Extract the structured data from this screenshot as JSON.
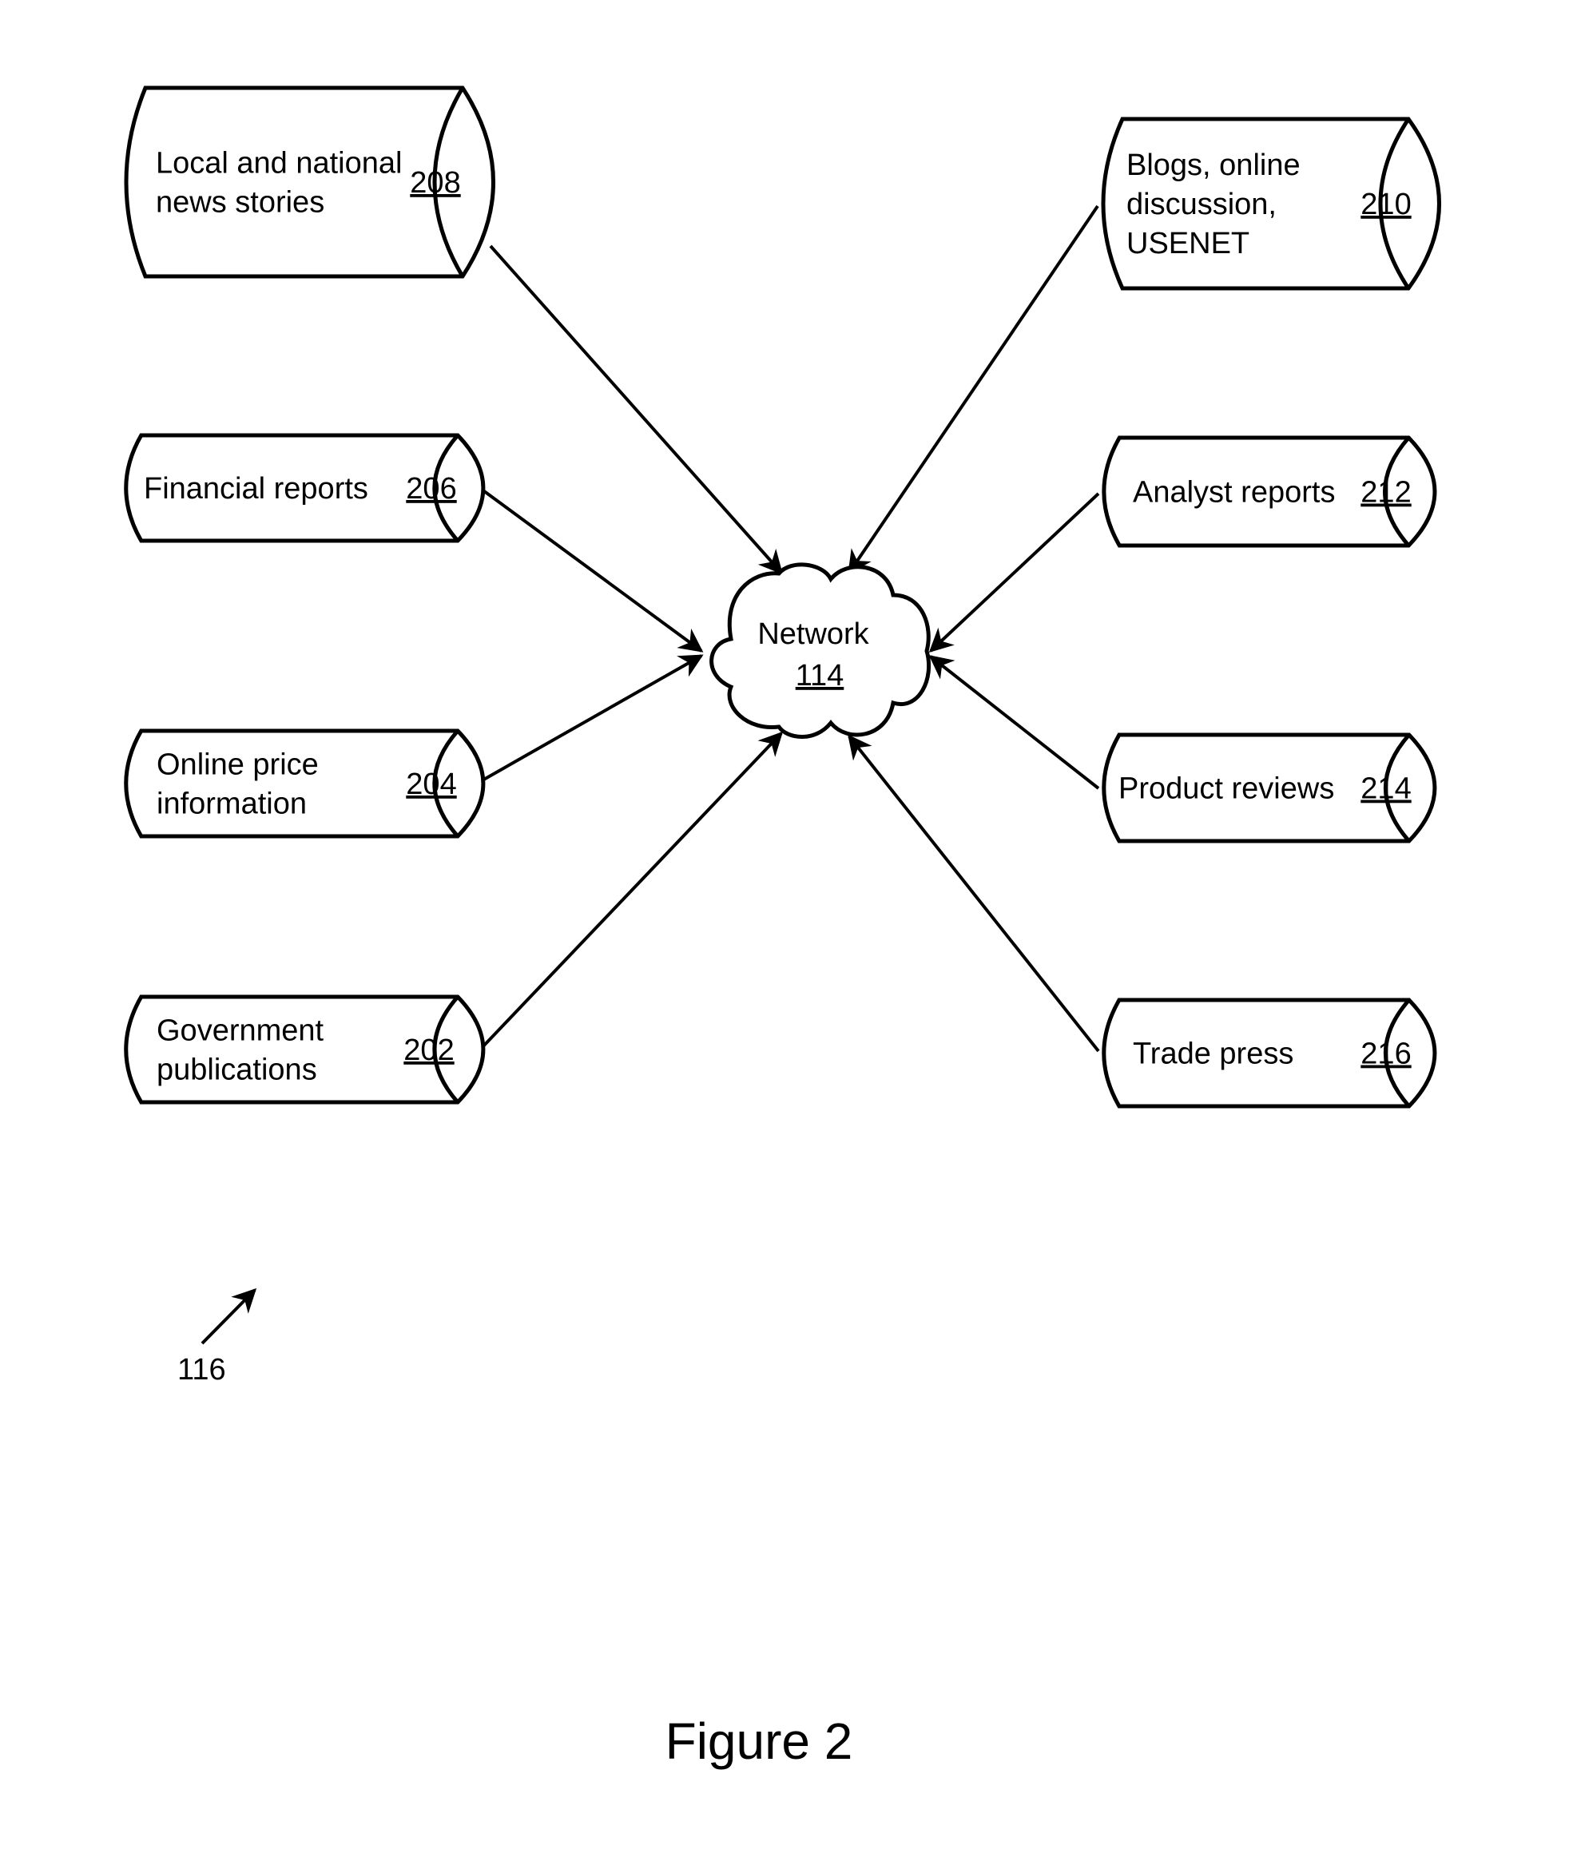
{
  "figure_caption": "Figure 2",
  "diagram_ref": "116",
  "network": {
    "label": "Network",
    "ref": "114"
  },
  "sources": [
    {
      "id": "208",
      "lines": [
        "Local and national",
        "news stories"
      ],
      "ref": "208",
      "side": "left"
    },
    {
      "id": "206",
      "lines": [
        "Financial reports"
      ],
      "ref": "206",
      "side": "left"
    },
    {
      "id": "204",
      "lines": [
        "Online price",
        "information"
      ],
      "ref": "204",
      "side": "left"
    },
    {
      "id": "202",
      "lines": [
        "Government",
        "publications"
      ],
      "ref": "202",
      "side": "left"
    },
    {
      "id": "210",
      "lines": [
        "Blogs, online",
        "discussion,",
        "USENET"
      ],
      "ref": "210",
      "side": "right"
    },
    {
      "id": "212",
      "lines": [
        "Analyst reports"
      ],
      "ref": "212",
      "side": "right"
    },
    {
      "id": "214",
      "lines": [
        "Product reviews"
      ],
      "ref": "214",
      "side": "right"
    },
    {
      "id": "216",
      "lines": [
        "Trade press"
      ],
      "ref": "216",
      "side": "right"
    }
  ],
  "edges": [
    {
      "from": "208",
      "to": "network"
    },
    {
      "from": "206",
      "to": "network"
    },
    {
      "from": "204",
      "to": "network"
    },
    {
      "from": "202",
      "to": "network"
    },
    {
      "from": "210",
      "to": "network"
    },
    {
      "from": "212",
      "to": "network"
    },
    {
      "from": "214",
      "to": "network"
    },
    {
      "from": "216",
      "to": "network"
    }
  ]
}
